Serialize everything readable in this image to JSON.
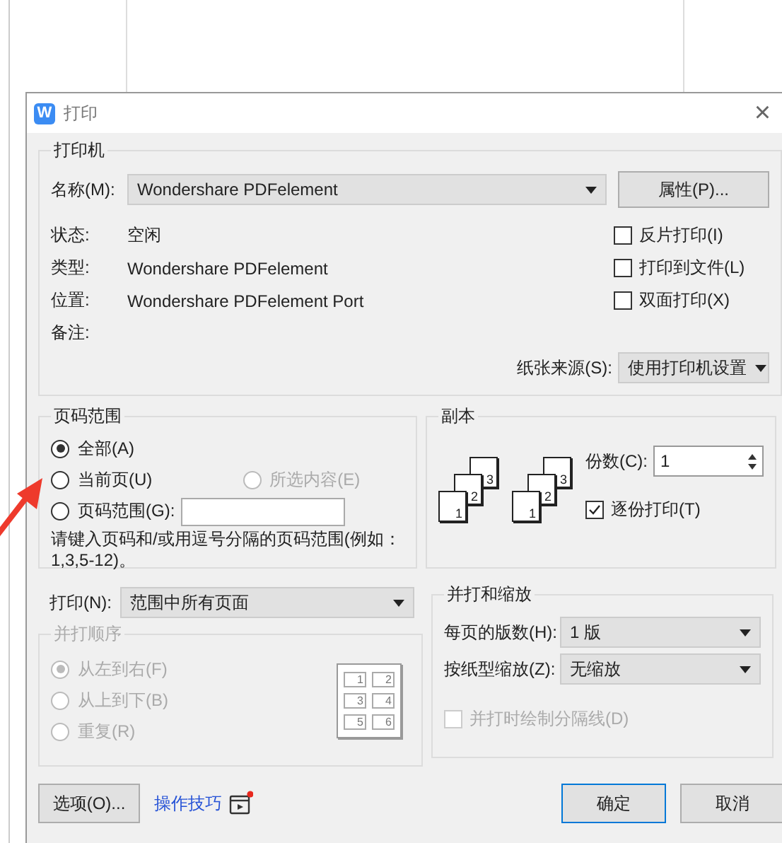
{
  "window": {
    "icon_letter": "W",
    "title": "打印",
    "close": "×"
  },
  "printer": {
    "title": "打印机",
    "name_label": "名称(M):",
    "name_value": "Wondershare PDFelement",
    "properties_button": "属性(P)...",
    "info": [
      {
        "label": "状态:",
        "value": "空闲"
      },
      {
        "label": "类型:",
        "value": "Wondershare PDFelement"
      },
      {
        "label": "位置:",
        "value": "Wondershare PDFelement Port"
      },
      {
        "label": "备注:"
      }
    ],
    "checkboxes": [
      {
        "label": "反片打印(I)",
        "checked": false
      },
      {
        "label": "打印到文件(L)",
        "checked": false
      },
      {
        "label": "双面打印(X)",
        "checked": false
      }
    ],
    "paper_source": {
      "label": "纸张来源(S):",
      "value": "使用打印机设置"
    }
  },
  "page_range": {
    "title": "页码范围",
    "options": [
      {
        "label": "全部(A)",
        "selected": true,
        "disabled": false
      },
      {
        "label": "当前页(U)",
        "selected": false,
        "disabled": false
      },
      {
        "label": "所选内容(E)",
        "selected": false,
        "disabled": true
      },
      {
        "label": "页码范围(G):",
        "selected": false,
        "disabled": false
      }
    ],
    "hint": "请键入页码和/或用逗号分隔的页码范围(例如：1,3,5-12)。"
  },
  "copies": {
    "title": "副本",
    "stacks": [
      [
        "1",
        "2",
        "3"
      ],
      [
        "1",
        "2",
        "3"
      ]
    ],
    "copies_label": "份数(C):",
    "copies_value": "1",
    "collate": {
      "label": "逐份打印(T)",
      "checked": true
    }
  },
  "print_what": {
    "label": "打印(N):",
    "value": "范围中所有页面"
  },
  "merge_order": {
    "title": "并打顺序",
    "disabled": true,
    "options": [
      {
        "label": "从左到右(F)",
        "selected": true
      },
      {
        "label": "从上到下(B)",
        "selected": false
      },
      {
        "label": "重复(R)",
        "selected": false
      }
    ],
    "pages": [
      "1",
      "2",
      "3",
      "4",
      "5",
      "6"
    ]
  },
  "zoom": {
    "title": "并打和缩放",
    "rows": [
      {
        "label": "每页的版数(H):",
        "value": "1 版"
      },
      {
        "label": "按纸型缩放(Z):",
        "value": "无缩放"
      }
    ],
    "separator": {
      "label": "并打时绘制分隔线(D)",
      "checked": false,
      "disabled": true
    }
  },
  "footer": {
    "options_button": "选项(O)...",
    "tips_link": "操作技巧",
    "tips_badge": true,
    "ok_button": "确定",
    "cancel_button": "取消"
  }
}
